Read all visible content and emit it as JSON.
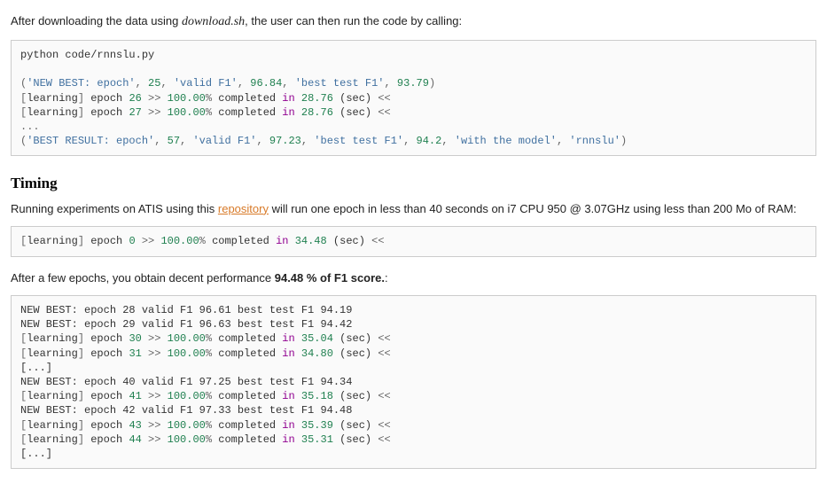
{
  "intro": {
    "prefix": "After downloading the data using ",
    "script_name": "download.sh",
    "suffix": ", the user can then run the code by calling:"
  },
  "code1": {
    "cmd": "python code/rnnslu.py",
    "line1": {
      "lp": "(",
      "s1": "'NEW BEST: epoch'",
      "c1": ", ",
      "n1": "25",
      "c2": ", ",
      "s2": "'valid F1'",
      "c3": ", ",
      "n2": "96.84",
      "c4": ", ",
      "s3": "'best test F1'",
      "c5": ", ",
      "n3": "93.79",
      "rp": ")"
    },
    "line2": {
      "lb": "[",
      "tag": "learning",
      "rb": "]",
      "sp": " epoch ",
      "num": "26",
      "arr1": " >> ",
      "pct": "100.00",
      "pctsign": "%",
      "mid": " completed ",
      "in": "in",
      "sp2": " ",
      "sec": "28.76",
      "tail": " (sec) ",
      "arr2": "<<"
    },
    "line3": {
      "lb": "[",
      "tag": "learning",
      "rb": "]",
      "sp": " epoch ",
      "num": "27",
      "arr1": " >> ",
      "pct": "100.00",
      "pctsign": "%",
      "mid": " completed ",
      "in": "in",
      "sp2": " ",
      "sec": "28.76",
      "tail": " (sec) ",
      "arr2": "<<"
    },
    "ellipsis": "...",
    "line4": {
      "lp": "(",
      "s1": "'BEST RESULT: epoch'",
      "c1": ", ",
      "n1": "57",
      "c2": ", ",
      "s2": "'valid F1'",
      "c3": ", ",
      "n2": "97.23",
      "c4": ", ",
      "s3": "'best test F1'",
      "c5": ", ",
      "n3": "94.2",
      "c6": ", ",
      "s4": "'with the model'",
      "c7": ", ",
      "s5": "'rnnslu'",
      "rp": ")"
    }
  },
  "timing": {
    "heading": "Timing",
    "p1_a": "Running experiments on ATIS using this ",
    "p1_link": "repository",
    "p1_b": " will run one epoch in less than 40 seconds on i7 CPU 950 @ 3.07GHz using less than 200 Mo of RAM:"
  },
  "code2": {
    "line": {
      "lb": "[",
      "tag": "learning",
      "rb": "]",
      "sp": " epoch ",
      "num": "0",
      "arr1": " >> ",
      "pct": "100.00",
      "pctsign": "%",
      "mid": " completed ",
      "in": "in",
      "sp2": " ",
      "sec": "34.48",
      "tail": " (sec) ",
      "arr2": "<<"
    }
  },
  "after": {
    "prefix": "After a few epochs, you obtain decent performance ",
    "bold": "94.48 % of F1 score.",
    "suffix": ":"
  },
  "code3": {
    "l1": "NEW BEST: epoch 28 valid F1 96.61 best test F1 94.19",
    "l2": "NEW BEST: epoch 29 valid F1 96.63 best test F1 94.42",
    "l3": {
      "lb": "[",
      "tag": "learning",
      "rb": "]",
      "sp": " epoch ",
      "num": "30",
      "arr1": " >> ",
      "pct": "100.00",
      "pctsign": "%",
      "mid": " completed ",
      "in": "in",
      "sp2": " ",
      "sec": "35.04",
      "tail": " (sec) ",
      "arr2": "<<"
    },
    "l4": {
      "lb": "[",
      "tag": "learning",
      "rb": "]",
      "sp": " epoch ",
      "num": "31",
      "arr1": " >> ",
      "pct": "100.00",
      "pctsign": "%",
      "mid": " completed ",
      "in": "in",
      "sp2": " ",
      "sec": "34.80",
      "tail": " (sec) ",
      "arr2": "<<"
    },
    "l5": "[...]",
    "l6": "NEW BEST: epoch 40 valid F1 97.25 best test F1 94.34",
    "l7": {
      "lb": "[",
      "tag": "learning",
      "rb": "]",
      "sp": " epoch ",
      "num": "41",
      "arr1": " >> ",
      "pct": "100.00",
      "pctsign": "%",
      "mid": " completed ",
      "in": "in",
      "sp2": " ",
      "sec": "35.18",
      "tail": " (sec) ",
      "arr2": "<<"
    },
    "l8": "NEW BEST: epoch 42 valid F1 97.33 best test F1 94.48",
    "l9": {
      "lb": "[",
      "tag": "learning",
      "rb": "]",
      "sp": " epoch ",
      "num": "43",
      "arr1": " >> ",
      "pct": "100.00",
      "pctsign": "%",
      "mid": " completed ",
      "in": "in",
      "sp2": " ",
      "sec": "35.39",
      "tail": " (sec) ",
      "arr2": "<<"
    },
    "l10": {
      "lb": "[",
      "tag": "learning",
      "rb": "]",
      "sp": " epoch ",
      "num": "44",
      "arr1": " >> ",
      "pct": "100.00",
      "pctsign": "%",
      "mid": " completed ",
      "in": "in",
      "sp2": " ",
      "sec": "35.31",
      "tail": " (sec) ",
      "arr2": "<<"
    },
    "l11": "[...]"
  }
}
